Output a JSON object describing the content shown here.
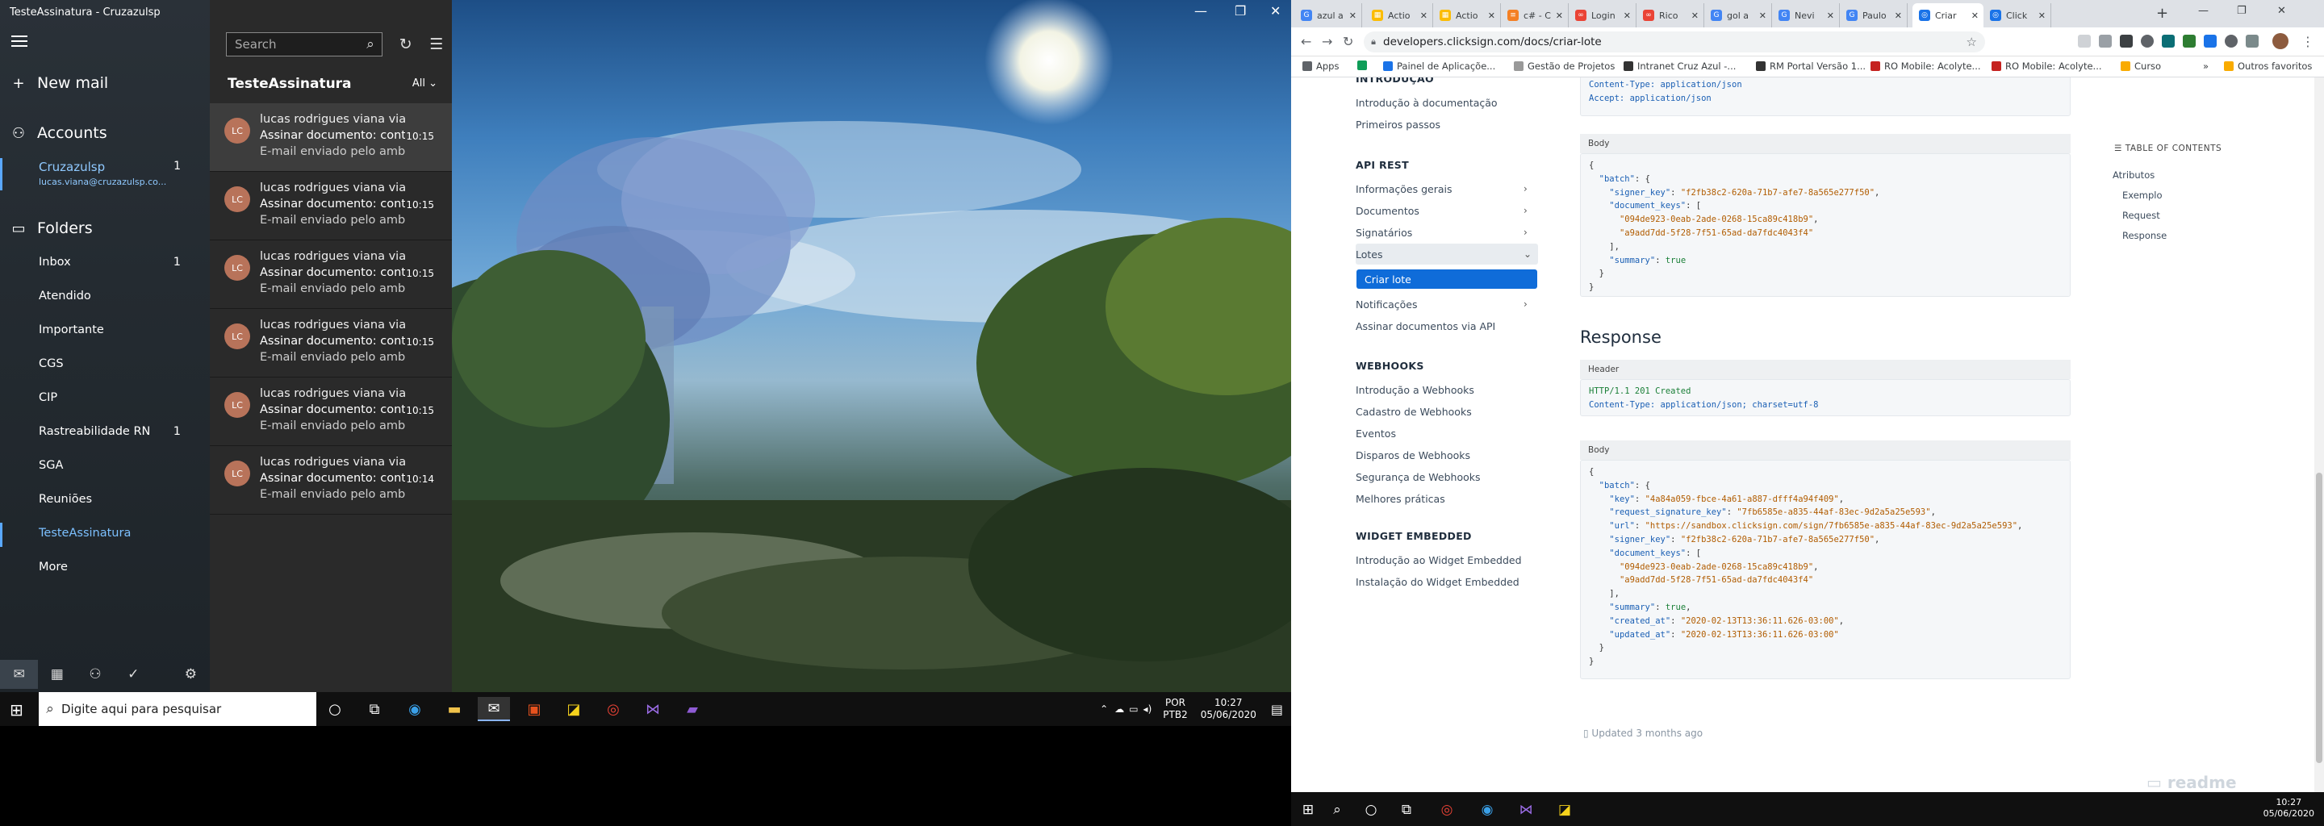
{
  "left": {
    "window_title": "TesteAssinatura - Cruzazulsp",
    "nav": {
      "new_mail": "New mail",
      "accounts": "Accounts",
      "account_name": "Cruzazulsp",
      "account_email": "lucas.viana@cruzazulsp.co...",
      "account_count": "1",
      "folders": "Folders",
      "folder_items": [
        {
          "label": "Inbox",
          "count": "1"
        },
        {
          "label": "Atendido",
          "count": ""
        },
        {
          "label": "Importante",
          "count": ""
        },
        {
          "label": "CGS",
          "count": ""
        },
        {
          "label": "CIP",
          "count": ""
        },
        {
          "label": "Rastreabilidade RN",
          "count": "1"
        },
        {
          "label": "SGA",
          "count": ""
        },
        {
          "label": "Reuniões",
          "count": ""
        },
        {
          "label": "TesteAssinatura",
          "count": ""
        },
        {
          "label": "More",
          "count": ""
        }
      ]
    },
    "list": {
      "search_placeholder": "Search",
      "folder_title": "TesteAssinatura",
      "filter": "All",
      "messages": [
        {
          "initials": "LC",
          "sender": "lucas rodrigues viana via Cl",
          "subject": "Assinar documento: contra",
          "preview": "E-mail enviado pelo ambie",
          "time": "10:15"
        },
        {
          "initials": "LC",
          "sender": "lucas rodrigues viana via Cl",
          "subject": "Assinar documento: contra",
          "preview": "E-mail enviado pelo ambie",
          "time": "10:15"
        },
        {
          "initials": "LC",
          "sender": "lucas rodrigues viana via Cl",
          "subject": "Assinar documento: contra",
          "preview": "E-mail enviado pelo ambie",
          "time": "10:15"
        },
        {
          "initials": "LC",
          "sender": "lucas rodrigues viana via Cl",
          "subject": "Assinar documento: contra",
          "preview": "E-mail enviado pelo ambie",
          "time": "10:15"
        },
        {
          "initials": "LC",
          "sender": "lucas rodrigues viana via Cl",
          "subject": "Assinar documento: contra",
          "preview": "E-mail enviado pelo ambie",
          "time": "10:15"
        },
        {
          "initials": "LC",
          "sender": "lucas rodrigues viana via Cl",
          "subject": "Assinar documento: contra",
          "preview": "E-mail enviado pelo ambie",
          "time": "10:14"
        }
      ]
    },
    "taskbar": {
      "search_placeholder": "Digite aqui para pesquisar",
      "lang_top": "POR",
      "lang_bottom": "PTB2",
      "time": "10:27",
      "date": "05/06/2020"
    }
  },
  "browser": {
    "tabs": [
      {
        "label": "azul a",
        "color": "#4285f4",
        "glyph": "G"
      },
      {
        "label": "Actio",
        "color": "#fbbc04",
        "glyph": "▦"
      },
      {
        "label": "Actio",
        "color": "#fbbc04",
        "glyph": "▦"
      },
      {
        "label": "c# - C",
        "color": "#f48024",
        "glyph": "≡"
      },
      {
        "label": "Login",
        "color": "#ea4335",
        "glyph": "∞"
      },
      {
        "label": "Rico",
        "color": "#ea4335",
        "glyph": "∞"
      },
      {
        "label": "gol a",
        "color": "#4285f4",
        "glyph": "G"
      },
      {
        "label": "Nevi",
        "color": "#4285f4",
        "glyph": "G"
      },
      {
        "label": "Paulo",
        "color": "#4285f4",
        "glyph": "G"
      },
      {
        "label": "Criar",
        "color": "#1a73e8",
        "glyph": "◎"
      },
      {
        "label": "Click",
        "color": "#1a73e8",
        "glyph": "◎"
      }
    ],
    "url": "developers.clicksign.com/docs/criar-lote",
    "bookmarks": [
      {
        "label": "Apps",
        "color": "#5f6368"
      },
      {
        "label": "",
        "color": "#0f9d58"
      },
      {
        "label": "Painel de Aplicaçõe...",
        "color": "#1a73e8"
      },
      {
        "label": "Gestão de Projetos",
        "color": "#999999"
      },
      {
        "label": "Intranet Cruz Azul -...",
        "color": "#333333"
      },
      {
        "label": "RM Portal Versão 1...",
        "color": "#333333"
      },
      {
        "label": "RO Mobile: Acolyte...",
        "color": "#c5221f"
      },
      {
        "label": "RO Mobile: Acolyte...",
        "color": "#c5221f"
      },
      {
        "label": "Curso",
        "color": "#f9ab00"
      },
      {
        "label": "Outros favoritos",
        "color": "#f9ab00"
      }
    ]
  },
  "docs": {
    "sidebar": {
      "top_cut": "INTRODUÇÃO",
      "intro_items": [
        "Introdução à documentação",
        "Primeiros passos"
      ],
      "api_head": "API REST",
      "api_items": [
        "Informações gerais",
        "Documentos",
        "Signatários",
        "Lotes",
        "Criar lote",
        "Notificações",
        "Assinar documentos via API"
      ],
      "webhooks_head": "WEBHOOKS",
      "webhooks_items": [
        "Introdução a Webhooks",
        "Cadastro de Webhooks",
        "Eventos",
        "Disparos de Webhooks",
        "Segurança de Webhooks",
        "Melhores práticas"
      ],
      "widget_head": "WIDGET EMBEDDED",
      "widget_items": [
        "Introdução ao Widget Embedded",
        "Instalação do Widget Embedded"
      ]
    },
    "request": {
      "header_lines": [
        "Content-Type: application/json",
        "Accept: application/json"
      ],
      "body_label": "Body",
      "batch_key": "\"batch\"",
      "signer_key": "\"signer_key\"",
      "signer_val": "\"f2fb38c2-620a-71b7-afe7-8a565e277f50\"",
      "doc_keys": "\"document_keys\"",
      "doc1": "\"094de923-0eab-2ade-0268-15ca89c418b9\"",
      "doc2": "\"a9add7dd-5f28-7f51-65ad-da7fdc4043f4\"",
      "summary_key": "\"summary\"",
      "summary_val": "true"
    },
    "response": {
      "title": "Response",
      "header_label": "Header",
      "status_line": "HTTP/1.1 201 Created",
      "content_type": "Content-Type: application/json; charset=utf-8",
      "body_label": "Body",
      "key_val": "\"4a84a059-fbce-4a61-a887-dfff4a94f409\"",
      "req_sig_val": "\"7fb6585e-a835-44af-83ec-9d2a5a25e593\"",
      "url_val": "\"https://sandbox.clicksign.com/sign/7fb6585e-a835-44af-83ec-9d2a5a25e593\"",
      "signer_val": "\"f2fb38c2-620a-71b7-afe7-8a565e277f50\"",
      "doc1": "\"094de923-0eab-2ade-0268-15ca89c418b9\"",
      "doc2": "\"a9add7dd-5f28-7f51-65ad-da7fdc4043f4\"",
      "created_at": "\"2020-02-13T13:36:11.626-03:00\"",
      "updated_at": "\"2020-02-13T13:36:11.626-03:00\""
    },
    "toc": {
      "head": "TABLE OF CONTENTS",
      "items": [
        "Atributos",
        "Exemplo",
        "Request",
        "Response"
      ]
    },
    "updated": "Updated 3 months ago",
    "brand": "readme"
  },
  "right_taskbar": {
    "time": "10:27",
    "date": "05/06/2020"
  }
}
